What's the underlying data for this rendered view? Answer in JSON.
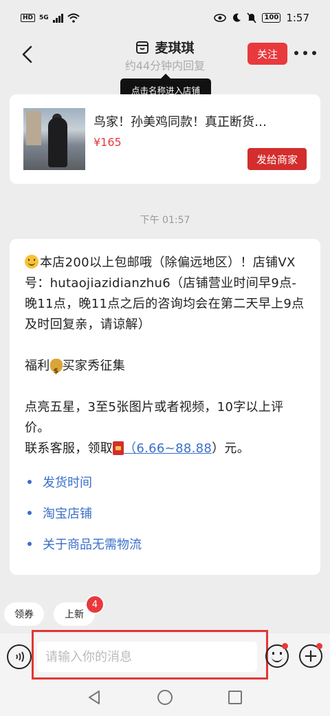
{
  "status_bar": {
    "network": "HD",
    "signal": "5G",
    "battery": "100",
    "time": "1:57"
  },
  "header": {
    "shop_name": "麦琪琪",
    "reply_time": "约44分钟内回复",
    "follow_label": "关注",
    "tooltip": "点击名称进入店铺"
  },
  "product": {
    "name": "鸟家！孙美鸡同款！真正断货…",
    "price": "¥165",
    "send_label": "发给商家"
  },
  "chat": {
    "time_divider": "下午 01:57",
    "message": {
      "para1": "本店200以上包邮哦（除偏远地区）！店铺VX号：hutaojiazidianzhu6（店铺营业时间早9点-晚11点，晚11点之后的咨询均会在第二天早上9点及时回复亲，请谅解）",
      "para2_a": "福利",
      "para2_b": "买家秀征集",
      "para3_line1": "点亮五星，3至5张图片或者视频，10字以上评价。",
      "para3_line2_a": "联系客服，领取",
      "para3_link": "（6.66~88.88",
      "para3_line2_b": "）元。"
    },
    "quick_links": [
      "发货时间",
      "淘宝店铺",
      "关于商品无需物流"
    ]
  },
  "chips": {
    "coupon": "领券",
    "new_arrivals": "上新",
    "new_badge": "4"
  },
  "input": {
    "placeholder": "请输入你的消息"
  },
  "colors": {
    "accent_red": "#e8393d",
    "link_blue": "#3a6fc9",
    "highlight_box": "#e23636"
  }
}
